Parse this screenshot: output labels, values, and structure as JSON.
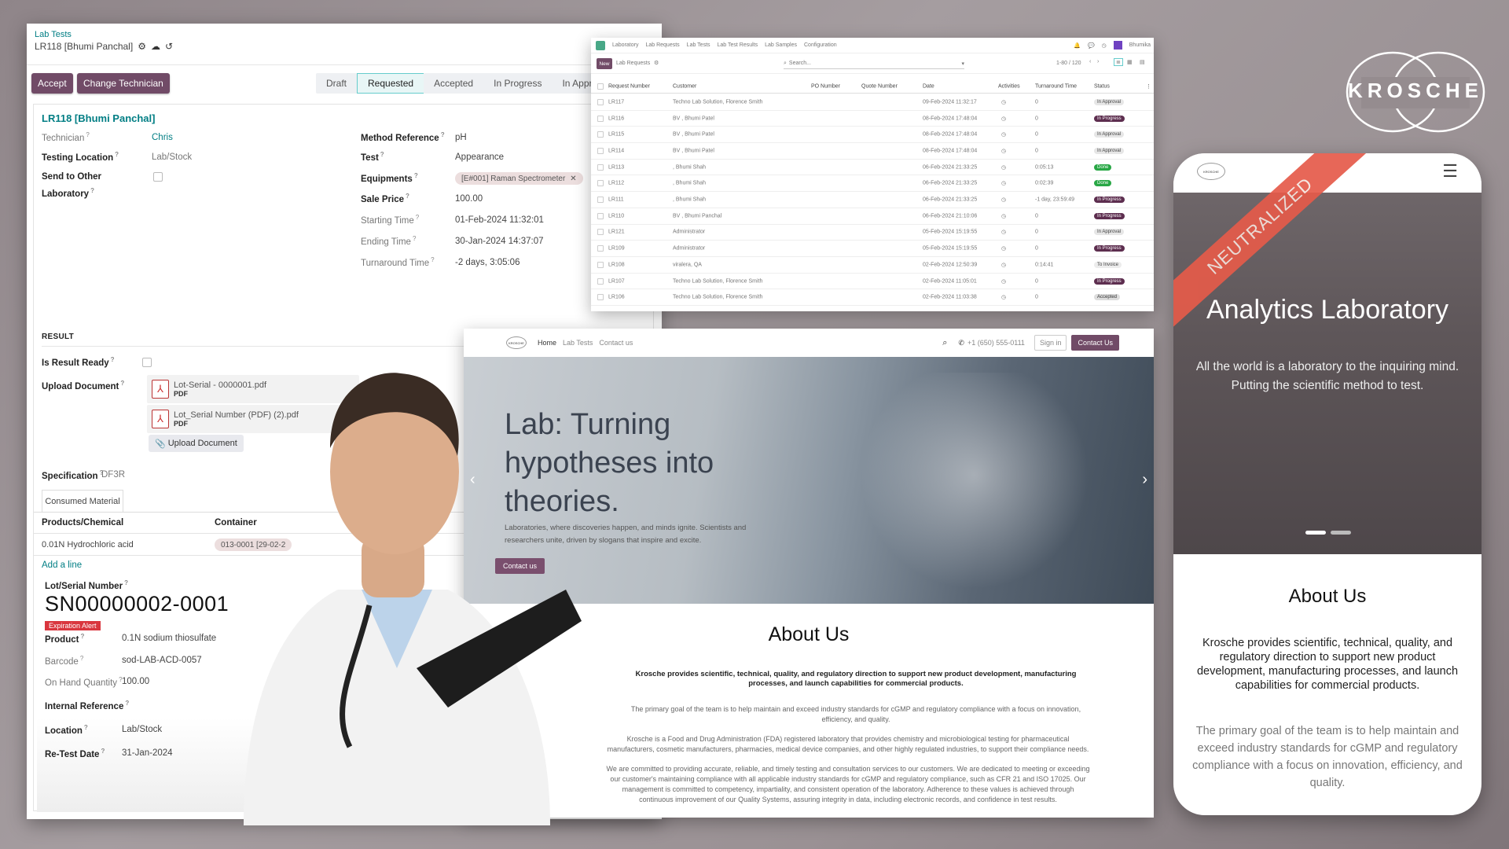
{
  "form": {
    "breadcrumb": "Lab Tests",
    "record_title": "LR118 [Bhumi Panchal]",
    "buttons": {
      "accept": "Accept",
      "change_technician": "Change Technician"
    },
    "statusbar": [
      "Draft",
      "Requested",
      "Accepted",
      "In Progress",
      "In Approval"
    ],
    "active_status": "Requested",
    "heading": "LR118 [Bhumi Panchal]",
    "left_fields": {
      "technician_label": "Technician",
      "technician_value": "Chris",
      "testing_location_label": "Testing Location",
      "testing_location_value": "Lab/Stock",
      "send_other_lab_label_1": "Send to Other",
      "send_other_lab_label_2": "Laboratory"
    },
    "right_fields": {
      "method_reference_label": "Method Reference",
      "method_reference_value": "pH",
      "test_label": "Test",
      "test_value": "Appearance",
      "equipments_label": "Equipments",
      "equipments_value": "[E#001] Raman Spectrometer",
      "sale_price_label": "Sale Price",
      "sale_price_value": "100.00",
      "starting_time_label": "Starting Time",
      "starting_time_value": "01-Feb-2024 11:32:01",
      "ending_time_label": "Ending Time",
      "ending_time_value": "30-Jan-2024 14:37:07",
      "turnaround_time_label": "Turnaround Time",
      "turnaround_time_value": "-2 days, 3:05:06"
    },
    "result_section": "RESULT",
    "is_result_ready_label": "Is Result Ready",
    "upload_document_label": "Upload Document",
    "attachments": [
      {
        "name": "Lot-Serial - 0000001.pdf",
        "type": "PDF"
      },
      {
        "name": "Lot_Serial Number (PDF) (2).pdf",
        "type": "PDF"
      }
    ],
    "upload_button": "Upload Document",
    "specification_label": "Specification",
    "specification_value": "DF3R",
    "tab_consumed": "Consumed Material",
    "table_headers": {
      "product": "Products/Chemical",
      "container": "Container"
    },
    "table_rows": [
      {
        "product": "0.01N Hydrochloric acid",
        "container": "013-0001 [29-02-2"
      }
    ],
    "add_line": "Add a line",
    "lot": {
      "label": "Lot/Serial Number",
      "value": "SN00000002-0001",
      "alert": "Expiration Alert",
      "product_label": "Product",
      "product_value": "0.1N sodium thiosulfate",
      "barcode_label": "Barcode",
      "barcode_value": "sod-LAB-ACD-0057",
      "onhand_label": "On Hand Quantity",
      "onhand_value": "100.00",
      "internal_ref_label": "Internal Reference",
      "location_label": "Location",
      "location_value": "Lab/Stock",
      "retest_label": "Re-Test Date",
      "retest_value": "31-Jan-2024"
    }
  },
  "list": {
    "menu": [
      "Laboratory",
      "Lab Requests",
      "Lab Tests",
      "Lab Test Results",
      "Lab Samples",
      "Configuration"
    ],
    "new_button": "New",
    "title": "Lab Requests",
    "search_placeholder": "Search...",
    "pager": "1-80 / 120",
    "user": "Bhumika",
    "columns": [
      "Request Number",
      "Customer",
      "PO Number",
      "Quote Number",
      "Date",
      "Activities",
      "Turnaround Time",
      "Status"
    ],
    "rows": [
      {
        "num": "LR117",
        "customer": "Techno Lab Solution, Florence Smith",
        "date": "09-Feb-2024 11:32:17",
        "tat": "0",
        "status": "In Approval",
        "cls": "b-appr"
      },
      {
        "num": "LR116",
        "customer": "BV , Bhumi Patel",
        "date": "08-Feb-2024 17:48:04",
        "tat": "0",
        "status": "In Progress",
        "cls": "b-prog"
      },
      {
        "num": "LR115",
        "customer": "BV , Bhumi Patel",
        "date": "08-Feb-2024 17:48:04",
        "tat": "0",
        "status": "In Approval",
        "cls": "b-appr"
      },
      {
        "num": "LR114",
        "customer": "BV , Bhumi Patel",
        "date": "08-Feb-2024 17:48:04",
        "tat": "0",
        "status": "In Approval",
        "cls": "b-appr"
      },
      {
        "num": "LR113",
        "customer": ", Bhumi Shah",
        "date": "06-Feb-2024 21:33:25",
        "tat": "0:05:13",
        "status": "Done",
        "cls": "b-done"
      },
      {
        "num": "LR112",
        "customer": ", Bhumi Shah",
        "date": "06-Feb-2024 21:33:25",
        "tat": "0:02:39",
        "status": "Done",
        "cls": "b-done"
      },
      {
        "num": "LR111",
        "customer": ", Bhumi Shah",
        "date": "06-Feb-2024 21:33:25",
        "tat": "-1 day, 23:59:49",
        "status": "In Progress",
        "cls": "b-prog"
      },
      {
        "num": "LR110",
        "customer": "BV , Bhumi Panchal",
        "date": "06-Feb-2024 21:10:06",
        "tat": "0",
        "status": "In Progress",
        "cls": "b-prog"
      },
      {
        "num": "LR121",
        "customer": "Administrator",
        "date": "05-Feb-2024 15:19:55",
        "tat": "0",
        "status": "In Approval",
        "cls": "b-appr"
      },
      {
        "num": "LR109",
        "customer": "Administrator",
        "date": "05-Feb-2024 15:19:55",
        "tat": "0",
        "status": "In Progress",
        "cls": "b-prog"
      },
      {
        "num": "LR108",
        "customer": "viralera, QA",
        "date": "02-Feb-2024 12:50:39",
        "tat": "0:14:41",
        "status": "To Invoice",
        "cls": "b-inv"
      },
      {
        "num": "LR107",
        "customer": "Techno Lab Solution, Florence Smith",
        "date": "02-Feb-2024 11:05:01",
        "tat": "0",
        "status": "In Progress",
        "cls": "b-prog"
      },
      {
        "num": "LR106",
        "customer": "Techno Lab Solution, Florence Smith",
        "date": "02-Feb-2024 11:03:38",
        "tat": "0",
        "status": "Accepted",
        "cls": "b-acc"
      }
    ]
  },
  "website": {
    "logo_text": "KROSCHE",
    "nav": [
      "Home",
      "Lab Tests",
      "Contact us"
    ],
    "phone": "+1 (650) 555-0111",
    "sign_in": "Sign in",
    "contact_us": "Contact Us",
    "hero_title": "Lab: Turning hypotheses into theories.",
    "hero_text": "Laboratories, where discoveries happen, and minds ignite. Scientists and researchers unite, driven by slogans that inspire and excite.",
    "hero_cta": "Contact us",
    "about_title": "About Us",
    "about_p1": "Krosche provides scientific, technical, quality, and regulatory direction to support new product development, manufacturing processes, and launch capabilities for commercial products.",
    "about_p2": "The primary goal of the team is to help maintain and exceed industry standards for cGMP and regulatory compliance with a focus on innovation, efficiency, and quality.",
    "about_p3": "Krosche is a Food and Drug Administration (FDA) registered laboratory that provides chemistry and microbiological testing for pharmaceutical manufacturers, cosmetic manufacturers, pharmacies, medical device companies, and other highly regulated industries, to support their compliance needs.",
    "about_p4": "We are committed to providing accurate, reliable, and timely testing and consultation services to our customers. We are dedicated to meeting or exceeding our customer's maintaining compliance with all applicable industry standards for cGMP and regulatory compliance, such as CFR 21 and ISO 17025. Our management is committed to competency, impartiality, and consistent operation of the laboratory. Adherence to these values is achieved through continuous improvement of our Quality Systems, assuring integrity in data, including electronic records, and confidence in test results."
  },
  "brand": {
    "name": "KROSCHE"
  },
  "mobile": {
    "logo_text": "KROSCHE",
    "ribbon": "NEUTRALIZED",
    "hero_title": "Analytics Laboratory",
    "hero_text": "All the world is a laboratory to the inquiring mind. Putting the scientific method to test.",
    "about_title": "About Us",
    "about_p1": "Krosche provides scientific, technical, quality, and regulatory direction to support new product development, manufacturing processes, and launch capabilities for commercial products.",
    "about_p2": "The primary goal of the team is to help maintain and exceed industry standards for cGMP and regulatory compliance with a focus on innovation, efficiency, and quality."
  },
  "colors": {
    "primary": "#714b67",
    "teal": "#017e84",
    "alert": "#d9363e",
    "ribbon": "#e55b4a"
  }
}
